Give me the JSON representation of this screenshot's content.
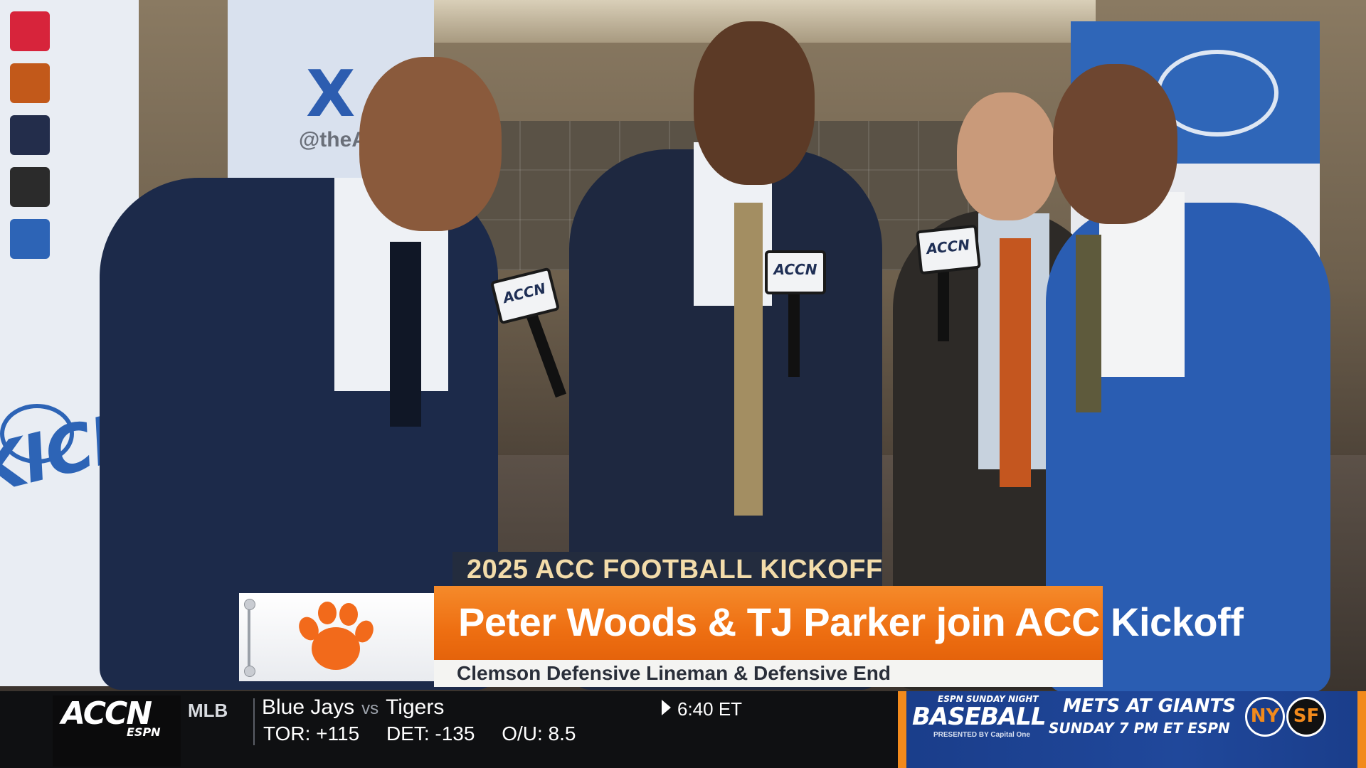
{
  "lower_third": {
    "event_title": "2025 ACC FOOTBALL KICKOFF",
    "headline": "Peter Woods & TJ Parker join ACC Kickoff",
    "subhead": "Clemson Defensive Lineman & Defensive End",
    "team_logo": "clemson-paw-icon",
    "accent_color": "#ee6f12"
  },
  "scene": {
    "backdrop_left_text": "KICKOFF",
    "backdrop_left_logo": "ACC",
    "backdrop_mid_icon": "X",
    "backdrop_mid_handle": "@theAC",
    "mic_flag": "ACCN"
  },
  "ticker": {
    "network": "ACCN",
    "network_sub": "ESPN",
    "league": "MLB",
    "away_team": "Blue Jays",
    "vs": "vs",
    "home_team": "Tigers",
    "odds": [
      "TOR: +115",
      "DET: -135",
      "O/U: 8.5"
    ],
    "game_time": "6:40 ET"
  },
  "promo": {
    "small_label": "ESPN SUNDAY NIGHT",
    "brand": "BASEBALL",
    "sponsor": "PRESENTED BY Capital One",
    "title": "METS AT GIANTS",
    "time": "SUNDAY 7 PM ET  ESPN",
    "team_logos": [
      "mets-logo-icon",
      "giants-logo-icon"
    ]
  }
}
